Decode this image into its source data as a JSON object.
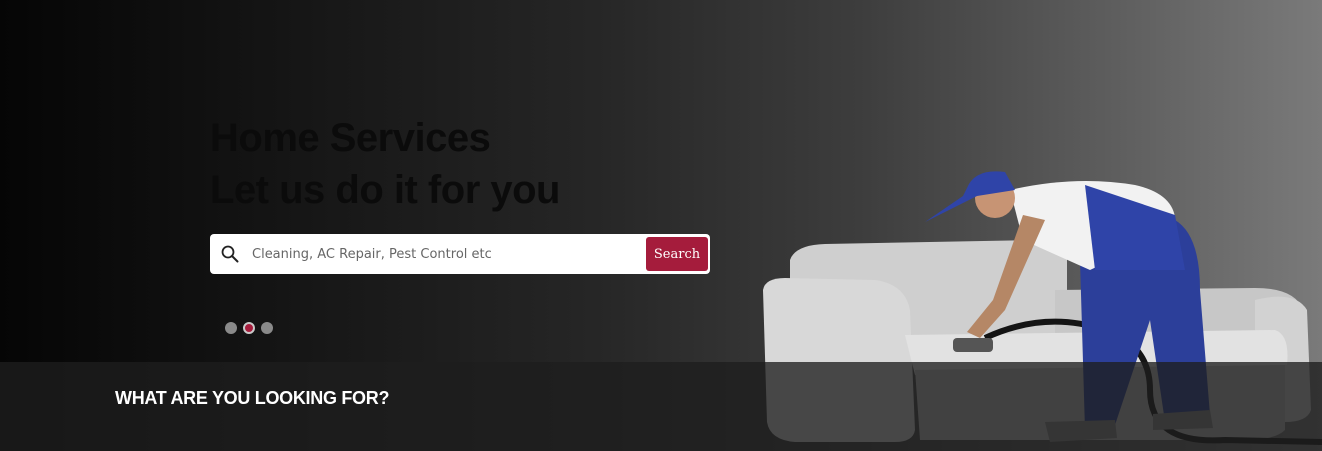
{
  "hero": {
    "headline_line1": "Home Services",
    "headline_line2": "Let us do it for you"
  },
  "search": {
    "placeholder": "Cleaning, AC Repair, Pest Control etc",
    "button_label": "Search",
    "icon": "search-icon"
  },
  "slider": {
    "dot_count": 3,
    "active_index": 1
  },
  "section": {
    "title": "WHAT ARE YOU LOOKING FOR?"
  },
  "colors": {
    "accent": "#a51c3c",
    "headline": "#0b0b0b",
    "band": "#1e1e1e"
  }
}
